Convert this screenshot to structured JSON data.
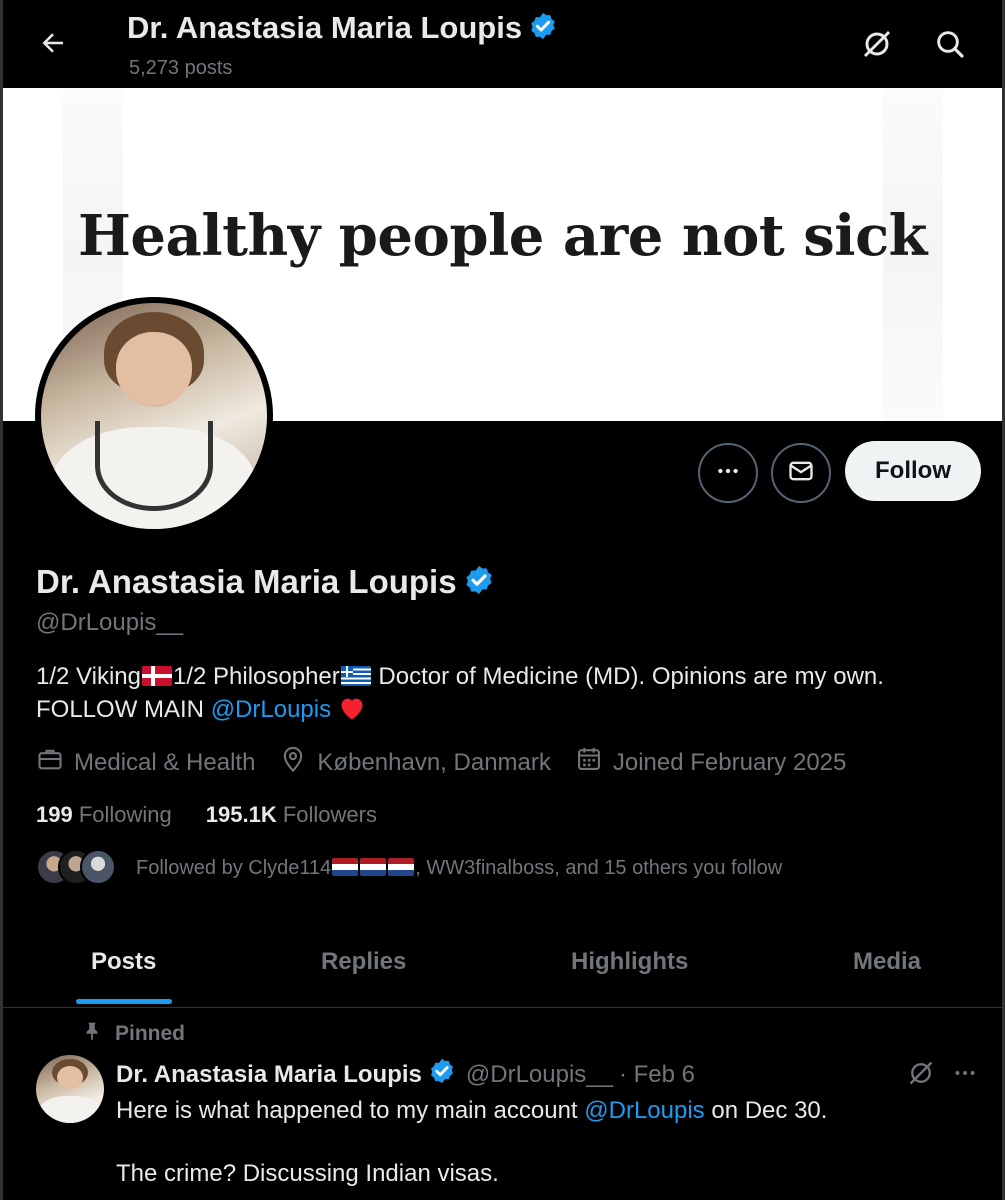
{
  "topbar": {
    "name": "Dr. Anastasia Maria Loupis",
    "posts_count": "5,273 posts"
  },
  "banner": {
    "text": "Healthy people are not sick"
  },
  "actions": {
    "follow_label": "Follow"
  },
  "profile": {
    "name": "Dr. Anastasia Maria Loupis",
    "handle": "@DrLoupis__",
    "bio": {
      "part1": "1/2 Viking",
      "part2": "1/2 Philosopher",
      "part3": " Doctor of Medicine (MD). Opinions are my own.",
      "part4": "FOLLOW MAIN ",
      "mention": "@DrLoupis"
    },
    "category": "Medical & Health",
    "location": "København, Danmark",
    "joined": "Joined February 2025",
    "following_count": "199",
    "following_label": "Following",
    "followers_count": "195.1K",
    "followers_label": "Followers",
    "followed_by_prefix": "Followed by Clyde114",
    "followed_by_suffix": ", WW3finalboss, and 15 others you follow"
  },
  "tabs": [
    {
      "label": "Posts",
      "active": true
    },
    {
      "label": "Replies",
      "active": false
    },
    {
      "label": "Highlights",
      "active": false
    },
    {
      "label": "Media",
      "active": false
    }
  ],
  "post": {
    "pinned_label": "Pinned",
    "author_name": "Dr. Anastasia Maria Loupis",
    "author_handle": "@DrLoupis__",
    "date": "· Feb 6",
    "text_before": "Here is what happened to my main account ",
    "mention": "@DrLoupis",
    "text_after": " on Dec 30.",
    "text_line2": "The crime? Discussing Indian visas."
  },
  "colors": {
    "accent": "#1d9bf0",
    "verified": "#1d9bf0",
    "muted": "#71767b",
    "heart": "#f4212e"
  },
  "icons": [
    "back-arrow-icon",
    "grok-icon",
    "search-icon",
    "more-icon",
    "mail-icon",
    "verified-badge-icon",
    "briefcase-icon",
    "location-pin-icon",
    "calendar-icon",
    "pin-icon",
    "heart-icon"
  ]
}
